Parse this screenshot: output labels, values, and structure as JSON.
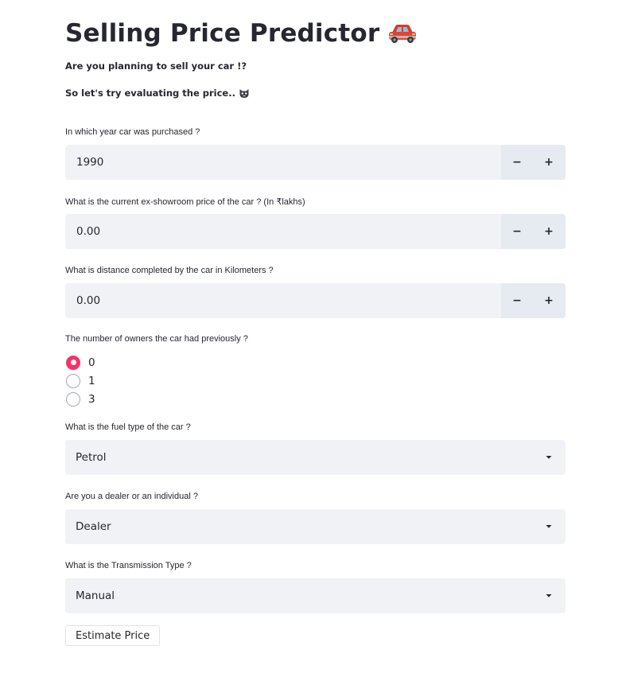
{
  "header": {
    "title": "Selling Price Predictor",
    "title_emoji": "car-icon"
  },
  "intro": {
    "line1": "Are you planning to sell your car !?",
    "line2": "So let's try evaluating the price..",
    "line2_emoji": "cat-face-icon"
  },
  "year": {
    "label": "In which year car was purchased ?",
    "value": "1990",
    "minus": "−",
    "plus": "+"
  },
  "price": {
    "label": "What is the current ex-showroom price of the car ? (In ₹lakhs)",
    "value": "0.00",
    "minus": "−",
    "plus": "+"
  },
  "distance": {
    "label": "What is distance completed by the car in Kilometers ?",
    "value": "0.00",
    "minus": "−",
    "plus": "+"
  },
  "owners": {
    "label": "The number of owners the car had previously ?",
    "options": [
      "0",
      "1",
      "3"
    ],
    "selected": "0"
  },
  "fuel": {
    "label": "What is the fuel type of the car ?",
    "value": "Petrol"
  },
  "seller": {
    "label": "Are you a dealer or an individual ?",
    "value": "Dealer"
  },
  "transmission": {
    "label": "What is the Transmission Type ?",
    "value": "Manual"
  },
  "action": {
    "estimate_label": "Estimate Price"
  },
  "colors": {
    "accent": "#f63366",
    "input_bg": "#f0f2f6",
    "text": "#262730"
  }
}
